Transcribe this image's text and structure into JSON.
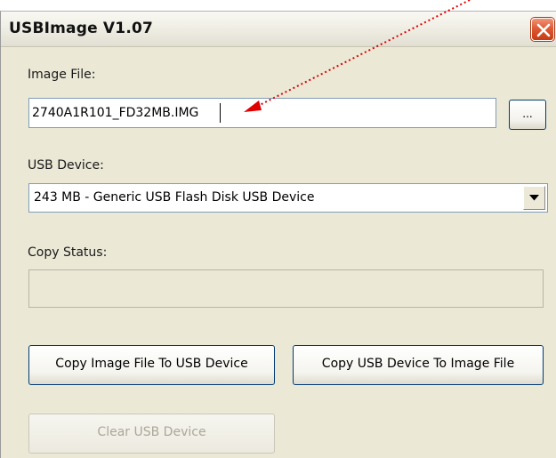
{
  "window": {
    "title": "USBImage V1.07"
  },
  "image_file": {
    "label": "Image File:",
    "value": "2740A1R101_FD32MB.IMG",
    "browse_label": "..."
  },
  "usb_device": {
    "label": "USB Device:",
    "selected": "243 MB - Generic USB Flash Disk USB Device"
  },
  "copy_status": {
    "label": "Copy Status:"
  },
  "buttons": {
    "copy_to_usb": "Copy Image File To USB Device",
    "copy_to_image": "Copy USB Device To Image File",
    "clear_usb": "Clear USB Device"
  },
  "colors": {
    "window_bg": "#ebe8d6",
    "close_button": "#df5a35",
    "annotation_arrow": "#e00000"
  },
  "icons": {
    "close": "close-icon",
    "dropdown": "chevron-down-icon",
    "annotation": "arrow-icon"
  }
}
